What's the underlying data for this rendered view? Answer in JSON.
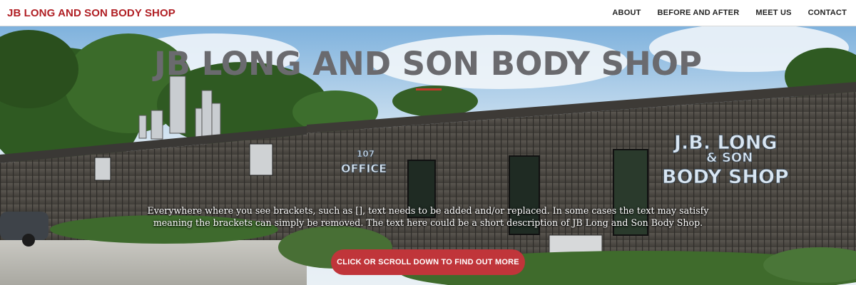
{
  "navbar": {
    "brand": "JB LONG AND SON BODY SHOP",
    "links": [
      {
        "label": "ABOUT"
      },
      {
        "label": "BEFORE AND AFTER"
      },
      {
        "label": "MEET US"
      },
      {
        "label": "CONTACT"
      }
    ]
  },
  "hero": {
    "title": "JB LONG AND SON BODY SHOP",
    "description": "Everywhere where you see brackets, such as [], text needs to be added and/or replaced. In some cases the text may satisfy meaning the brackets can simply be removed. The text here could be a short description of JB Long and Son Body Shop.",
    "cta_label": "CLICK OR SCROLL DOWN TO FIND OUT MORE",
    "building_sign": {
      "line1": "J.B. LONG",
      "line2": "& SON",
      "line3": "BODY SHOP",
      "office": "OFFICE",
      "number": "107"
    }
  },
  "colors": {
    "brand_red": "#b01f24",
    "button_red": "#c0353a",
    "title_gray": "#6a6a6e"
  }
}
